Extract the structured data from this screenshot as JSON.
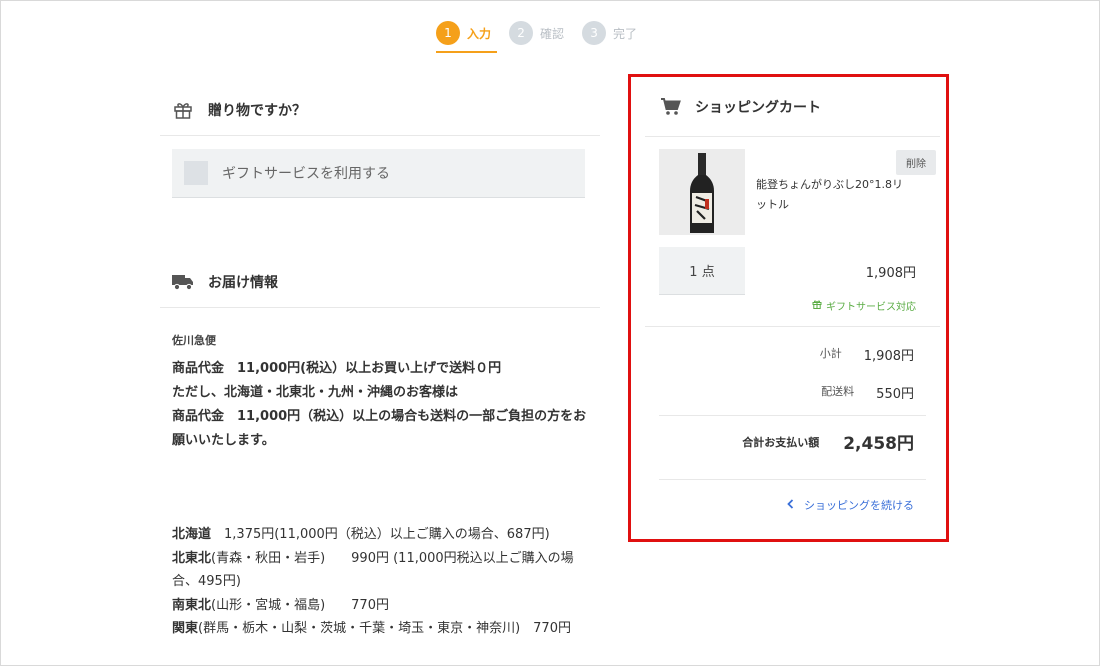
{
  "steps": [
    {
      "num": "1",
      "label": "入力",
      "active": true
    },
    {
      "num": "2",
      "label": "確認",
      "active": false
    },
    {
      "num": "3",
      "label": "完了",
      "active": false
    }
  ],
  "gift_section": {
    "title": "贈り物ですか？",
    "checkbox_label": "ギフトサービスを利用する",
    "icon": "gift-icon"
  },
  "delivery_section": {
    "title": "お届け情報",
    "icon": "truck-icon",
    "carrier": "佐川急便",
    "notice_lines": [
      "商品代金　11,000円(税込）以上お買い上げで送料０円",
      "ただし、北海道・北東北・九州・沖縄のお客様は",
      "商品代金　11,000円（税込）以上の場合も送料の一部ご負担の方をお願いいたします。"
    ],
    "rates": [
      {
        "region": "北海道",
        "detail": "　1,375円(11,000円（税込）以上ご購入の場合、687円)"
      },
      {
        "region": "北東北",
        "detail": "(青森・秋田・岩手)　　990円 (11,000円税込以上ご購入の場合、495円)"
      },
      {
        "region": "南東北",
        "detail": "(山形・宮城・福島)　　770円"
      },
      {
        "region": "関東",
        "detail": "(群馬・栃木・山梨・茨城・千葉・埼玉・東京・神奈川)　770円"
      }
    ]
  },
  "cart": {
    "title": "ショッピングカート",
    "icon": "cart-icon",
    "item": {
      "name": "能登ちょんがりぶし20°1.8リットル",
      "delete_label": "削除",
      "quantity": "1 点",
      "price": "1,908円",
      "gift_ok": "ギフトサービス対応"
    },
    "subtotal_label": "小計",
    "subtotal": "1,908円",
    "shipping_label": "配送料",
    "shipping": "550円",
    "total_label": "合計お支払い額",
    "total": "2,458円",
    "continue_label": "ショッピングを続ける"
  },
  "colors": {
    "accent": "#f5a01a",
    "highlight_border": "#e01010",
    "link": "#3a6fd8",
    "gift_green": "#5aac44"
  }
}
